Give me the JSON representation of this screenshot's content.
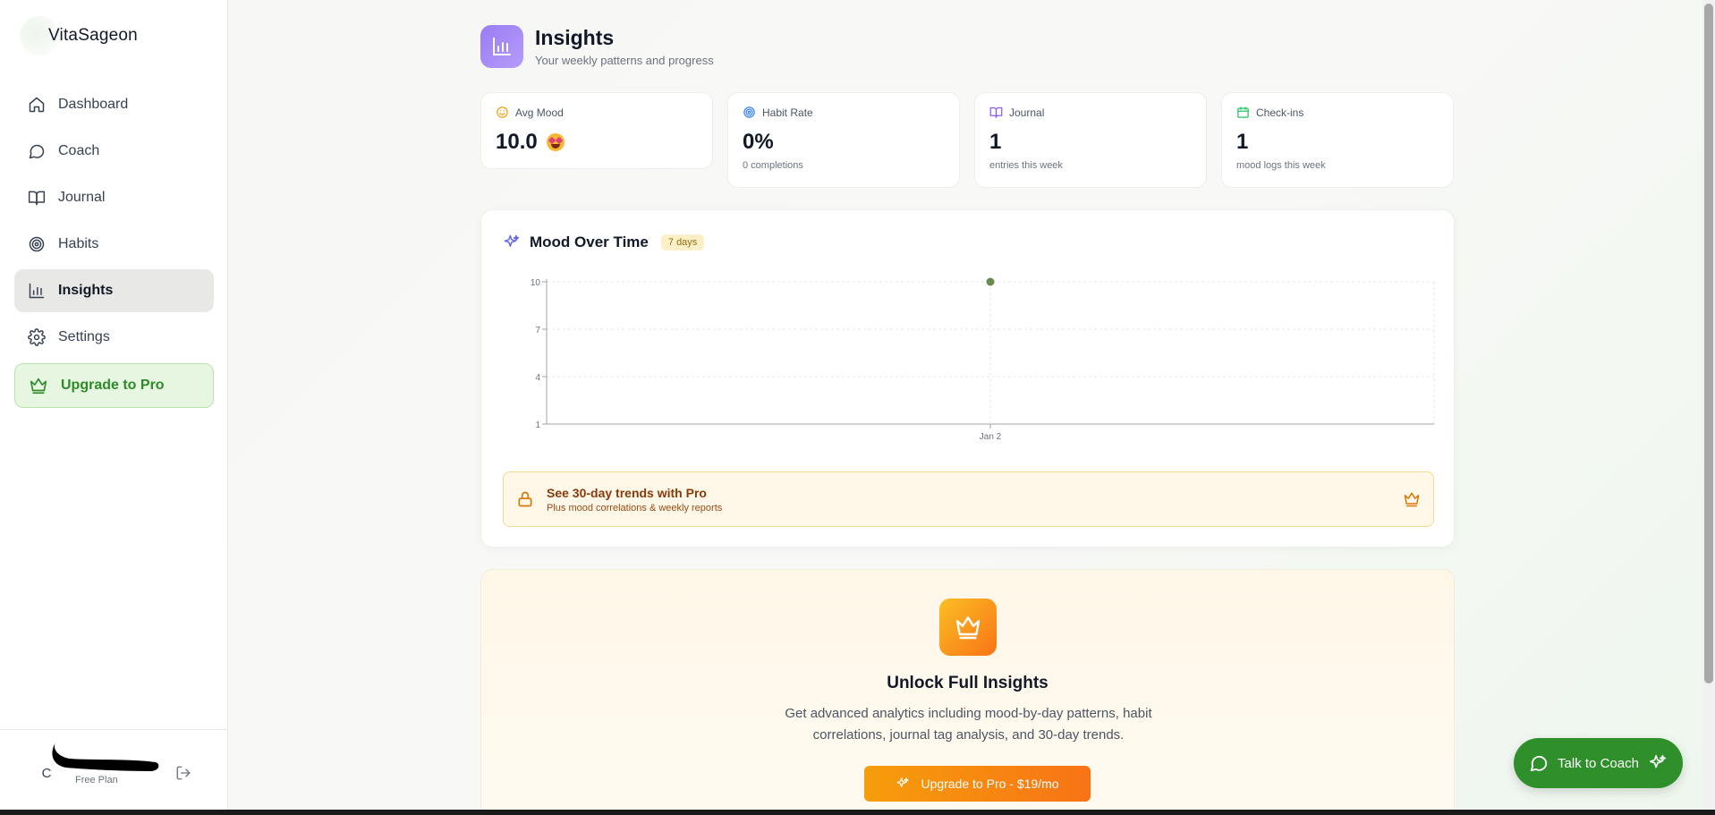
{
  "sidebar": {
    "brand": "VitaSageon",
    "items": [
      {
        "label": "Dashboard"
      },
      {
        "label": "Coach"
      },
      {
        "label": "Journal"
      },
      {
        "label": "Habits"
      },
      {
        "label": "Insights"
      },
      {
        "label": "Settings"
      }
    ],
    "upgrade_label": "Upgrade to Pro",
    "user_initial": "C",
    "plan": "Free Plan"
  },
  "header": {
    "title": "Insights",
    "subtitle": "Your weekly patterns and progress"
  },
  "stats": [
    {
      "label": "Avg Mood",
      "value": "10.0",
      "sub": ""
    },
    {
      "label": "Habit Rate",
      "value": "0%",
      "sub": "0 completions"
    },
    {
      "label": "Journal",
      "value": "1",
      "sub": "entries this week"
    },
    {
      "label": "Check-ins",
      "value": "1",
      "sub": "mood logs this week"
    }
  ],
  "mood_chart": {
    "title": "Mood Over Time",
    "badge": "7 days"
  },
  "chart_data": {
    "type": "line",
    "title": "Mood Over Time",
    "x": [
      "Jan 2"
    ],
    "series": [
      {
        "values": [
          10
        ]
      }
    ],
    "yticks": [
      1,
      4,
      7,
      10
    ],
    "ylim": [
      1,
      10
    ],
    "grid": true,
    "colors": {
      "point": "#6b8a4e",
      "axis": "#9ca3af",
      "grid": "#e5e7eb"
    }
  },
  "pro_banner": {
    "title": "See 30-day trends with Pro",
    "subtitle": "Plus mood correlations & weekly reports"
  },
  "unlock": {
    "title": "Unlock Full Insights",
    "description": "Get advanced analytics including mood-by-day patterns, habit correlations, journal tag analysis, and 30-day trends.",
    "button": "Upgrade to Pro - $19/mo"
  },
  "coach_button": "Talk to Coach",
  "colors": {
    "accent_green": "#2f8f2a",
    "accent_purple": "#9b7cf5",
    "accent_orange": "#f97316"
  }
}
